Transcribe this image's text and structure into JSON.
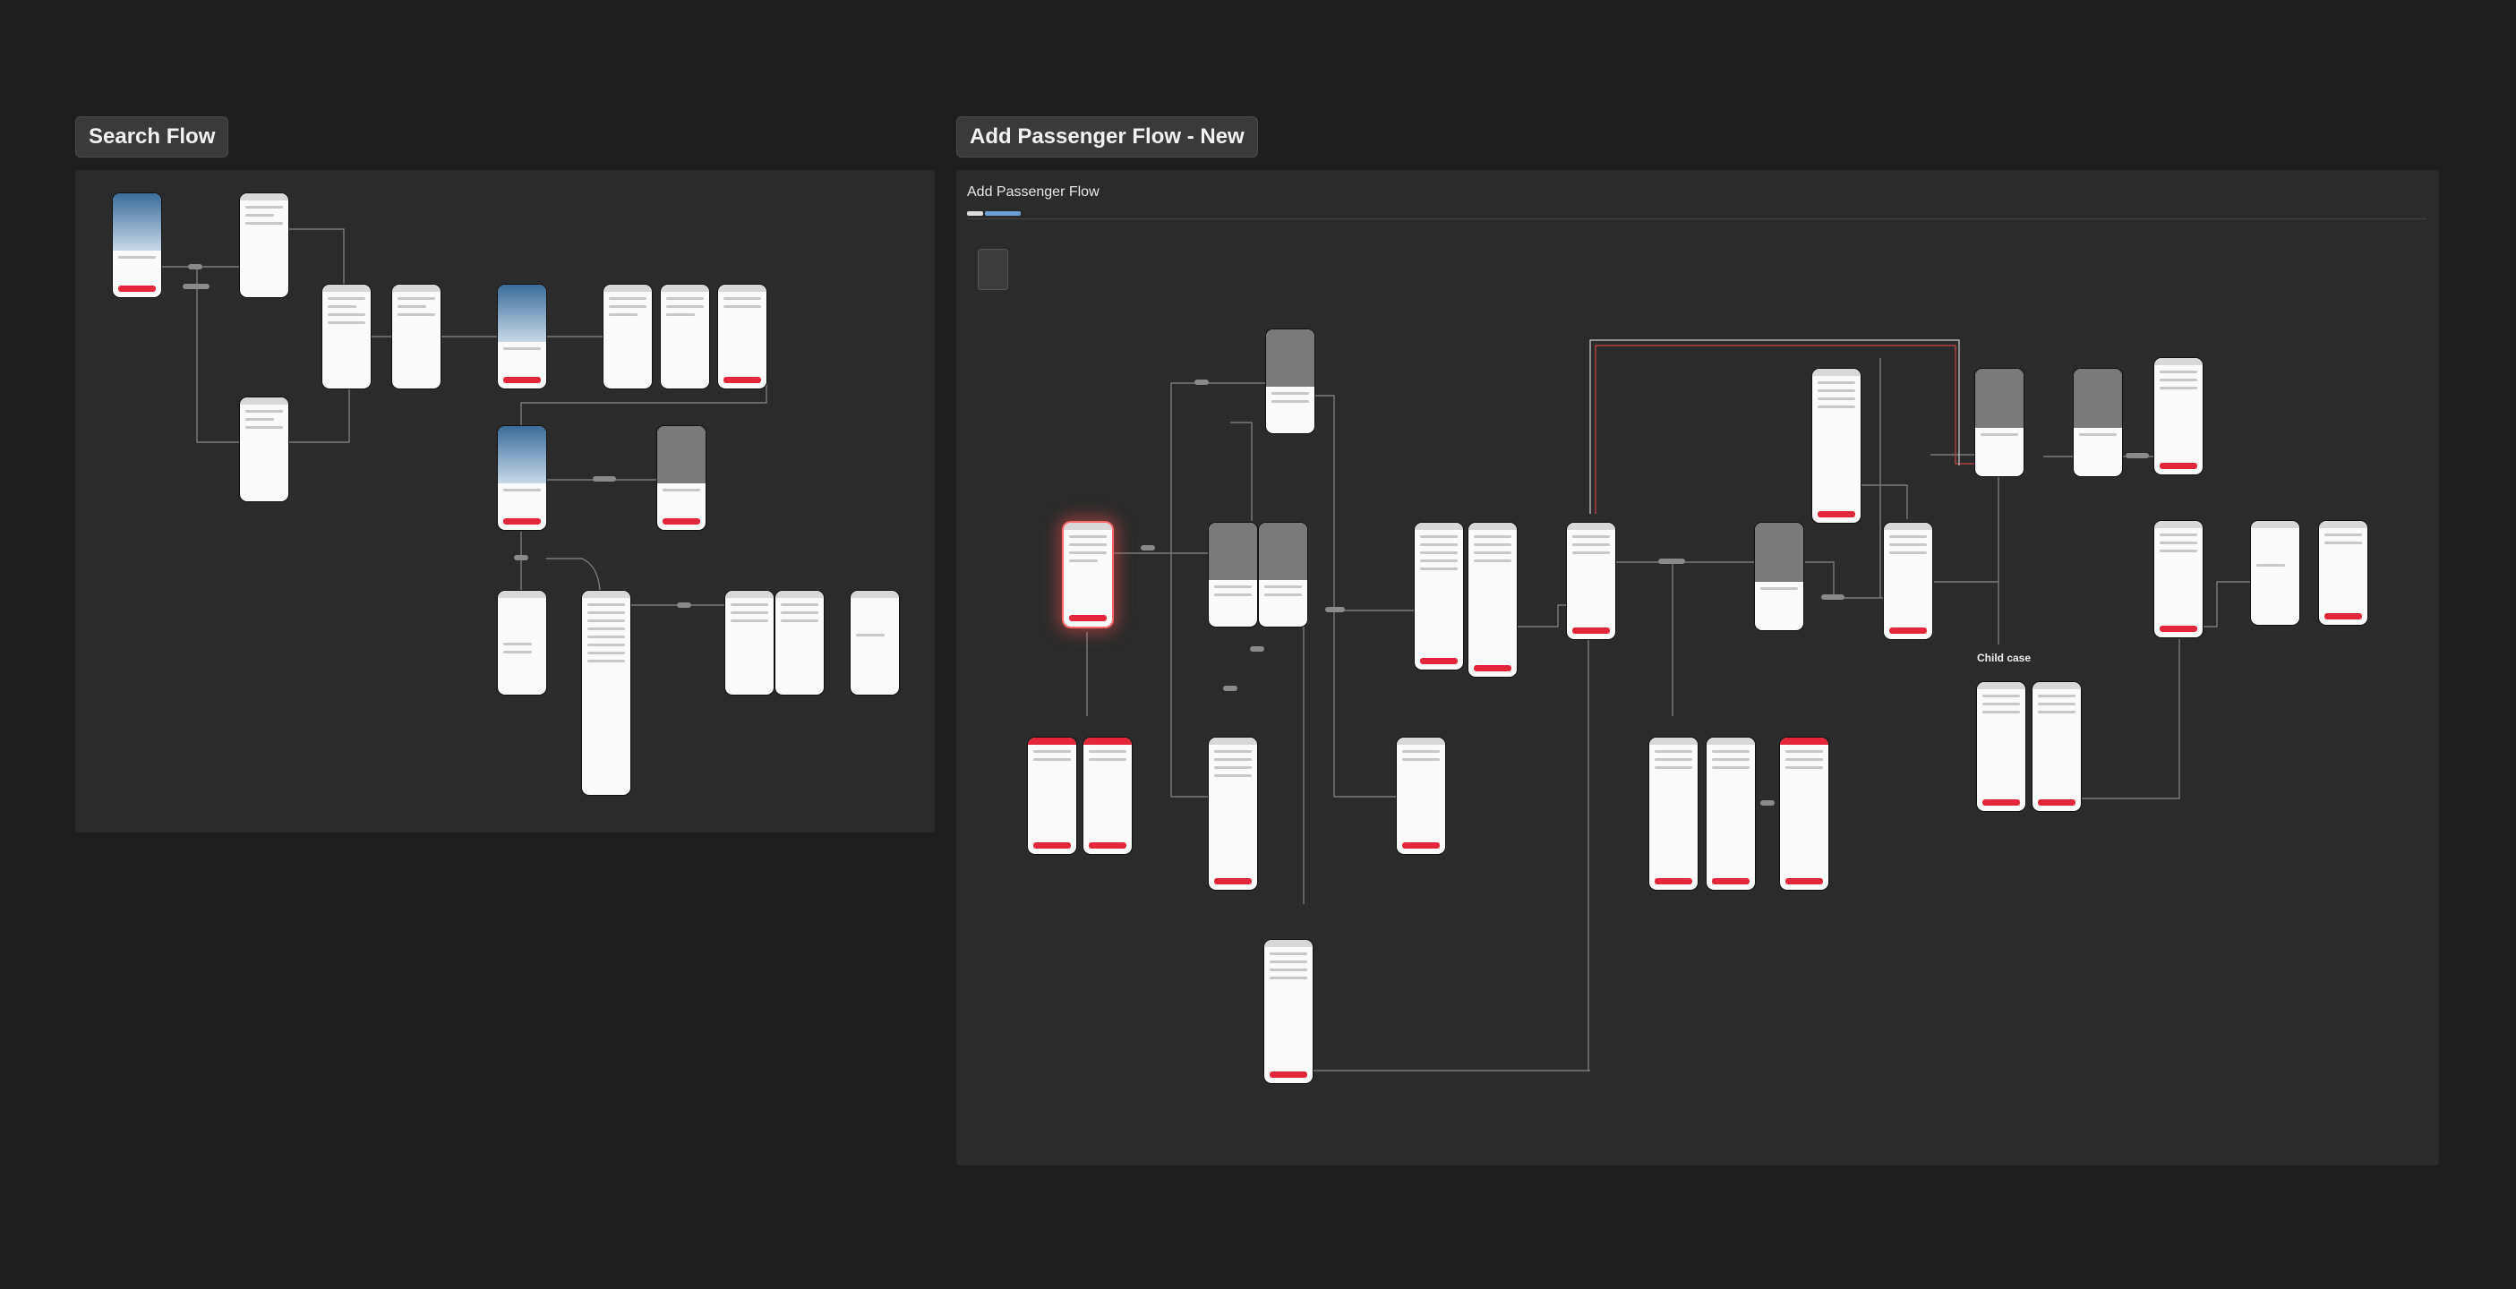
{
  "sections": {
    "search_flow": {
      "label": "Search Flow"
    },
    "add_passenger_flow": {
      "label": "Add Passenger Flow - New",
      "board_title": "Add Passenger Flow"
    }
  },
  "child_case": {
    "label": "Child case"
  },
  "colors": {
    "canvas": "#1e1e1e",
    "board": "#2b2b2b",
    "accent_red": "#e4263a",
    "highlight": "#ff6b6b"
  }
}
